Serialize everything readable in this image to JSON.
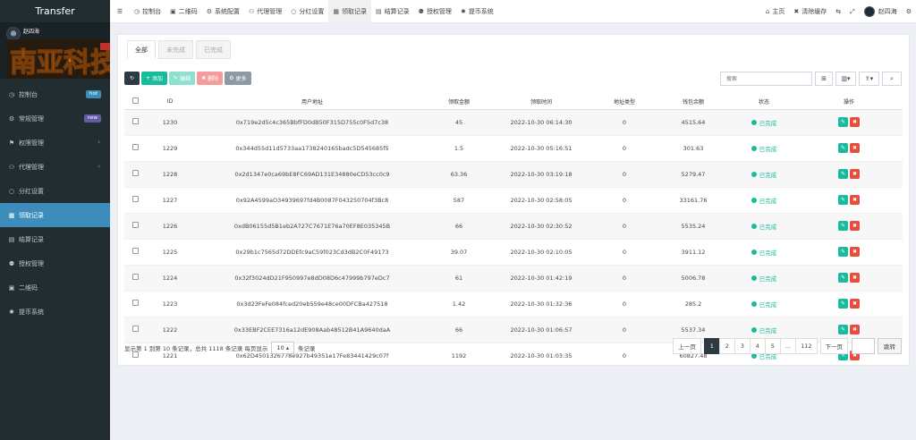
{
  "sidebar": {
    "brand": "Transfer",
    "user_name": "赵四海",
    "logo_text": "南亚科技",
    "items": [
      {
        "label": "控制台",
        "icon": "dashboard-icon",
        "badge": "hot"
      },
      {
        "label": "常规管理",
        "icon": "cogs-icon",
        "badge": "new"
      },
      {
        "label": "权限管理",
        "icon": "group-icon",
        "chevron": "‹"
      },
      {
        "label": "代理管理",
        "icon": "user-icon",
        "chevron": "‹"
      },
      {
        "label": "分红设置",
        "icon": "circle-icon"
      },
      {
        "label": "领取记录",
        "icon": "list-icon",
        "active": true
      },
      {
        "label": "结算记录",
        "icon": "table-icon"
      },
      {
        "label": "授权管理",
        "icon": "users-icon"
      },
      {
        "label": "二维码",
        "icon": "qrcode-icon"
      },
      {
        "label": "提币系统",
        "icon": "gear-icon"
      }
    ]
  },
  "topbar": {
    "nav": [
      {
        "label": "控制台",
        "icon": "dashboard-icon"
      },
      {
        "label": "二维码",
        "icon": "qrcode-icon"
      },
      {
        "label": "系统配置",
        "icon": "cog-icon"
      },
      {
        "label": "代理管理",
        "icon": "user-icon"
      },
      {
        "label": "分红设置",
        "icon": "circle-icon"
      },
      {
        "label": "领取记录",
        "icon": "list-icon",
        "active": true
      },
      {
        "label": "结算记录",
        "icon": "table-icon"
      },
      {
        "label": "授权管理",
        "icon": "users-icon"
      },
      {
        "label": "提币系统",
        "icon": "gear-icon"
      }
    ],
    "home": "主页",
    "clear_cache": "清除缓存",
    "user": "赵四海"
  },
  "tabs": [
    "全部",
    "未完成",
    "已完成"
  ],
  "toolbar": {
    "add": "添加",
    "edit": "编辑",
    "delete": "删除",
    "more": "更多"
  },
  "search": {
    "placeholder": "搜索"
  },
  "table": {
    "headers": [
      "ID",
      "用户地址",
      "领取金额",
      "领取时间",
      "地址类型",
      "钱包余额",
      "状态",
      "操作"
    ],
    "rows": [
      {
        "id": "1230",
        "address": "0x719e2d5c4c365BbfFD0dB50F315D755c0F5d7c38",
        "amount": "45",
        "time": "2022-10-30 06:14:30",
        "type": "0",
        "balance": "4515.64",
        "status": "已完成"
      },
      {
        "id": "1229",
        "address": "0x344d55d11d5733aa1738240165badc5D545685f5",
        "amount": "1.5",
        "time": "2022-10-30 05:16:51",
        "type": "0",
        "balance": "301.63",
        "status": "已完成"
      },
      {
        "id": "1228",
        "address": "0x2d1347e0ca69bE8FC69AD131E34880eCD53cc0c9",
        "amount": "63.36",
        "time": "2022-10-30 03:19:18",
        "type": "0",
        "balance": "5279.47",
        "status": "已完成"
      },
      {
        "id": "1227",
        "address": "0x92A4599aO34939697fd4B0087F043250704f3Bc8",
        "amount": "587",
        "time": "2022-10-30 02:58:05",
        "type": "0",
        "balance": "33161.76",
        "status": "已完成"
      },
      {
        "id": "1226",
        "address": "0xdB06155d5B1eb2A727C7671E76a70EF8E035345B",
        "amount": "66",
        "time": "2022-10-30 02:30:52",
        "type": "0",
        "balance": "5535.24",
        "status": "已完成"
      },
      {
        "id": "1225",
        "address": "0x29b1c7565d72DDEfc9aC59f023Cd3dB2C0F49173",
        "amount": "39.07",
        "time": "2022-10-30 02:10:05",
        "type": "0",
        "balance": "3911.12",
        "status": "已完成"
      },
      {
        "id": "1224",
        "address": "0x32f3024dD21F950997e8dD08D6c47999b797eDc7",
        "amount": "61",
        "time": "2022-10-30 01:42:19",
        "type": "0",
        "balance": "5006.78",
        "status": "已完成"
      },
      {
        "id": "1223",
        "address": "0x3d23FeFe084fced20eb559e48ce00DFCBa427518",
        "amount": "1.42",
        "time": "2022-10-30 01:32:36",
        "type": "0",
        "balance": "285.2",
        "status": "已完成"
      },
      {
        "id": "1222",
        "address": "0x33EBF2CEE7316a12dE908Aab48512B41A9640daA",
        "amount": "66",
        "time": "2022-10-30 01:06:57",
        "type": "0",
        "balance": "5537.34",
        "status": "已完成"
      },
      {
        "id": "1221",
        "address": "0x62D4501326778e927b49351e17Fe83441429c07f",
        "amount": "1192",
        "time": "2022-10-30 01:03:35",
        "type": "0",
        "balance": "60827.48",
        "status": "已完成"
      }
    ]
  },
  "pager": {
    "info_prefix": "显示第 1 到第 10 条记录，总共 1118 条记录 每页显示",
    "page_size": "10",
    "info_suffix": "条记录",
    "prev": "上一页",
    "pages": [
      "1",
      "2",
      "3",
      "4",
      "5",
      "...",
      "112"
    ],
    "next": "下一页",
    "jump": "跳转"
  },
  "colors": {
    "accent": "#3c8dbc",
    "success": "#18bc9c",
    "danger": "#e74c3c",
    "sidebar": "#222d32"
  }
}
